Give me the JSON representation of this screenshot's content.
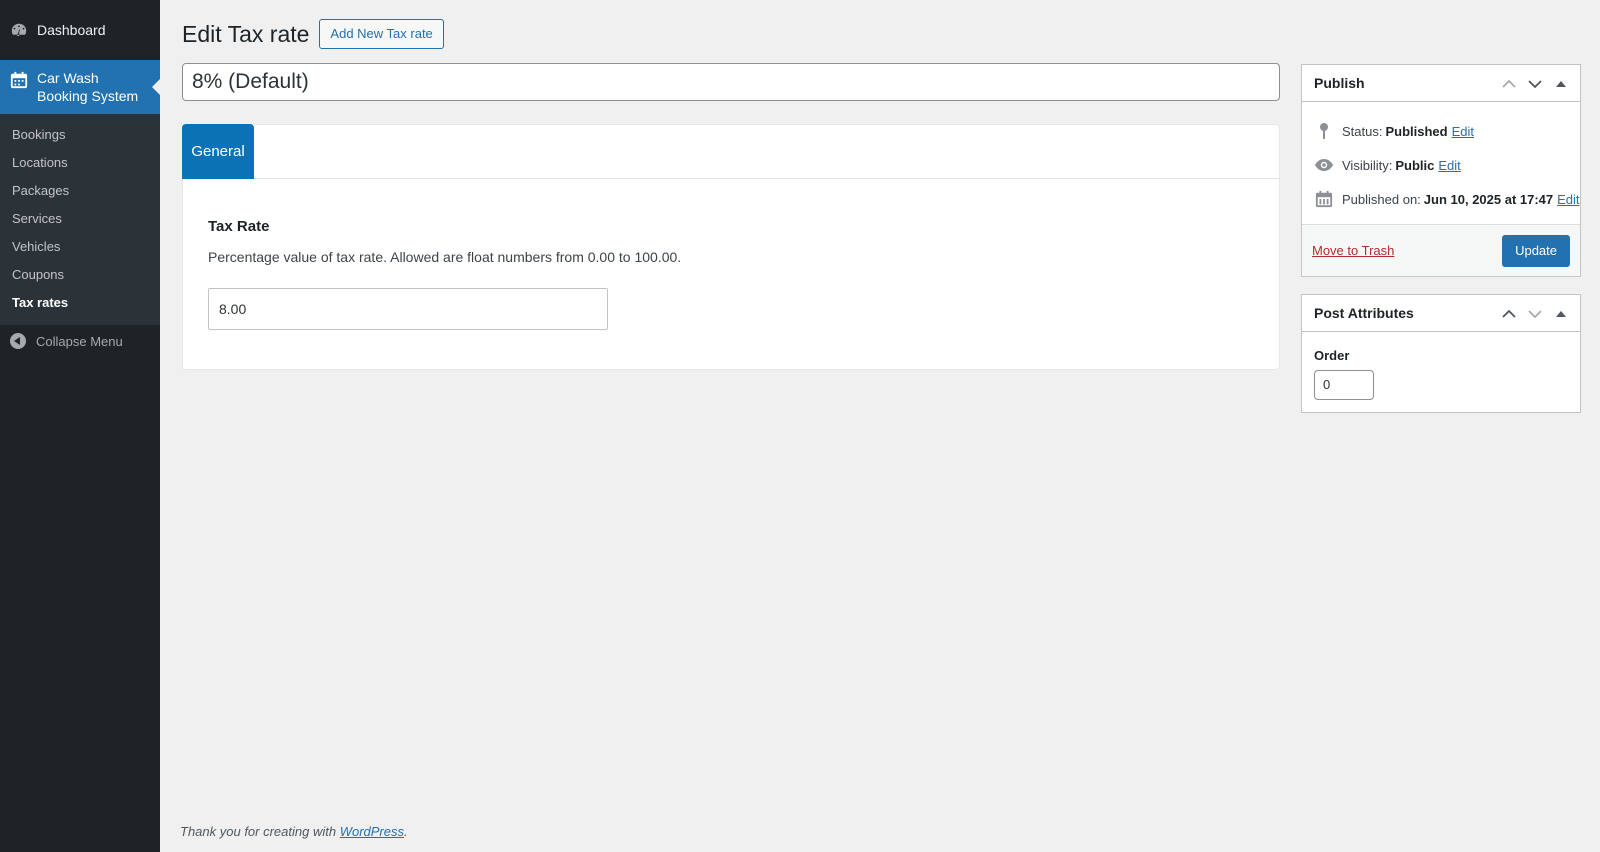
{
  "sidebar": {
    "dashboard_label": "Dashboard",
    "current_menu_label": "Car Wash Booking System",
    "items": [
      {
        "label": "Bookings"
      },
      {
        "label": "Locations"
      },
      {
        "label": "Packages"
      },
      {
        "label": "Services"
      },
      {
        "label": "Vehicles"
      },
      {
        "label": "Coupons"
      },
      {
        "label": "Tax rates",
        "current": true
      }
    ],
    "collapse_label": "Collapse Menu"
  },
  "header": {
    "title": "Edit Tax rate",
    "add_new_label": "Add New Tax rate"
  },
  "post": {
    "title_value": "8% (Default)"
  },
  "meta_box": {
    "tab_label": "General",
    "field_label": "Tax Rate",
    "field_description": "Percentage value of tax rate. Allowed are float numbers from 0.00 to 100.00.",
    "field_value": "8.00"
  },
  "publish_box": {
    "title": "Publish",
    "status_label": "Status:",
    "status_value": "Published",
    "visibility_label": "Visibility:",
    "visibility_value": "Public",
    "published_on_label": "Published on:",
    "published_on_value": "Jun 10, 2025 at 17:47",
    "edit_label": "Edit",
    "trash_label": "Move to Trash",
    "update_label": "Update"
  },
  "attributes_box": {
    "title": "Post Attributes",
    "order_label": "Order",
    "order_value": "0"
  },
  "footer": {
    "text": "Thank you for creating with",
    "link": "WordPress",
    "suffix": "."
  },
  "colors": {
    "sidebar_bg": "#1d2327",
    "accent": "#2271b1",
    "tab_active": "#0a72b5",
    "trash": "#b32d2e"
  }
}
